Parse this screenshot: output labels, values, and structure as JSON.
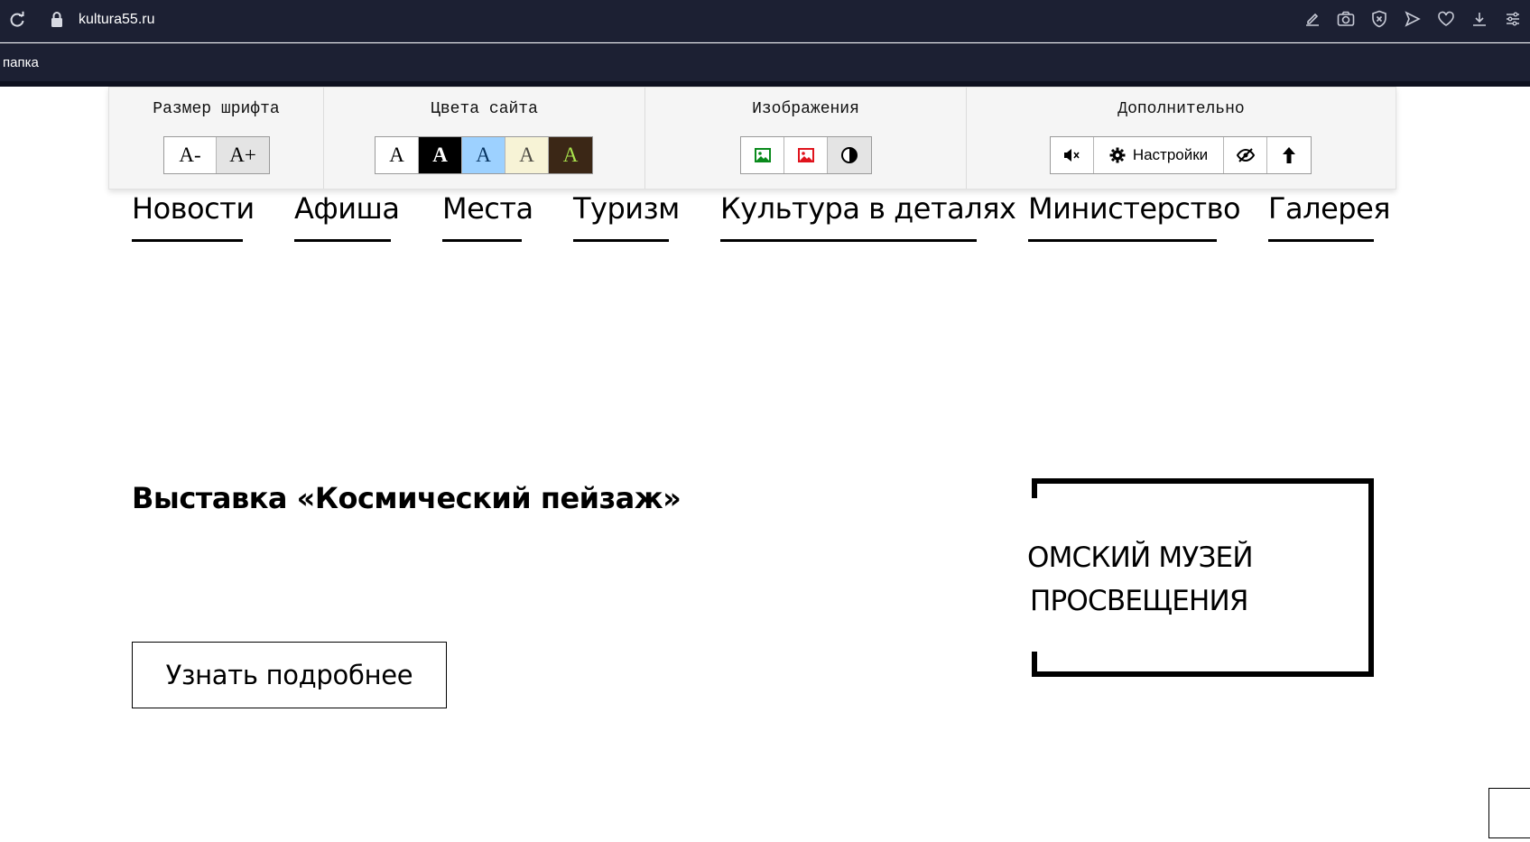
{
  "browser": {
    "url": "kultura55.ru",
    "bookmark": "папка",
    "toolbar_icons": [
      "edit-icon",
      "camera-icon",
      "shield-icon",
      "send-icon",
      "heart-icon",
      "download-icon",
      "menu-icon"
    ]
  },
  "a11y_panel": {
    "font_size": {
      "title": "Размер шрифта",
      "decrease": "A-",
      "increase": "A+"
    },
    "colors": {
      "title": "Цвета сайта",
      "schemes": [
        {
          "label": "A",
          "bg": "#ffffff",
          "fg": "#000000"
        },
        {
          "label": "A",
          "bg": "#000000",
          "fg": "#ffffff"
        },
        {
          "label": "A",
          "bg": "#9dd1ff",
          "fg": "#063462"
        },
        {
          "label": "A",
          "bg": "#f7f3d6",
          "fg": "#4d4b43"
        },
        {
          "label": "A",
          "bg": "#3b2716",
          "fg": "#a9e44d"
        }
      ]
    },
    "images": {
      "title": "Изображения",
      "on_icon": "image-on-icon",
      "off_icon": "image-off-icon",
      "gray_icon": "contrast-icon"
    },
    "extra": {
      "title": "Дополнительно",
      "settings_label": "Настройки"
    }
  },
  "nav": [
    "Новости",
    "Афиша",
    "Места",
    "Туризм",
    "Культура в деталях",
    "Министерство",
    "Галерея"
  ],
  "hero": {
    "title": "Выставка «Космический пейзаж»",
    "button": "Узнать подробнее",
    "museum_line1": "ОМСКИЙ МУЗЕЙ",
    "museum_line2": "ПРОСВЕЩЕНИЯ"
  }
}
